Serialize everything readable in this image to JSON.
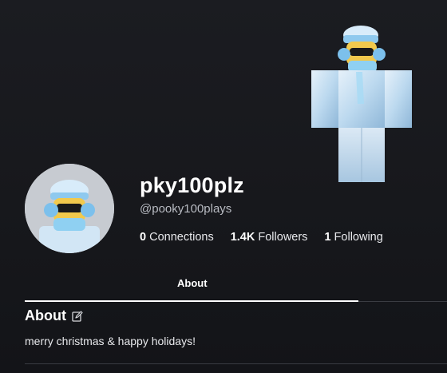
{
  "profile": {
    "display_name": "pky100plz",
    "username": "@pooky100plays"
  },
  "stats": [
    {
      "count": "0",
      "label": "Connections"
    },
    {
      "count": "1.4K",
      "label": "Followers"
    },
    {
      "count": "1",
      "label": "Following"
    }
  ],
  "tabs": {
    "active_label": "About"
  },
  "about": {
    "title": "About",
    "text": "merry christmas & happy holidays!",
    "edit_icon": "edit-icon"
  },
  "colors": {
    "background": "#17181c",
    "text_primary": "#ffffff",
    "text_secondary": "#b8bbc2",
    "divider": "#3a3c42"
  }
}
